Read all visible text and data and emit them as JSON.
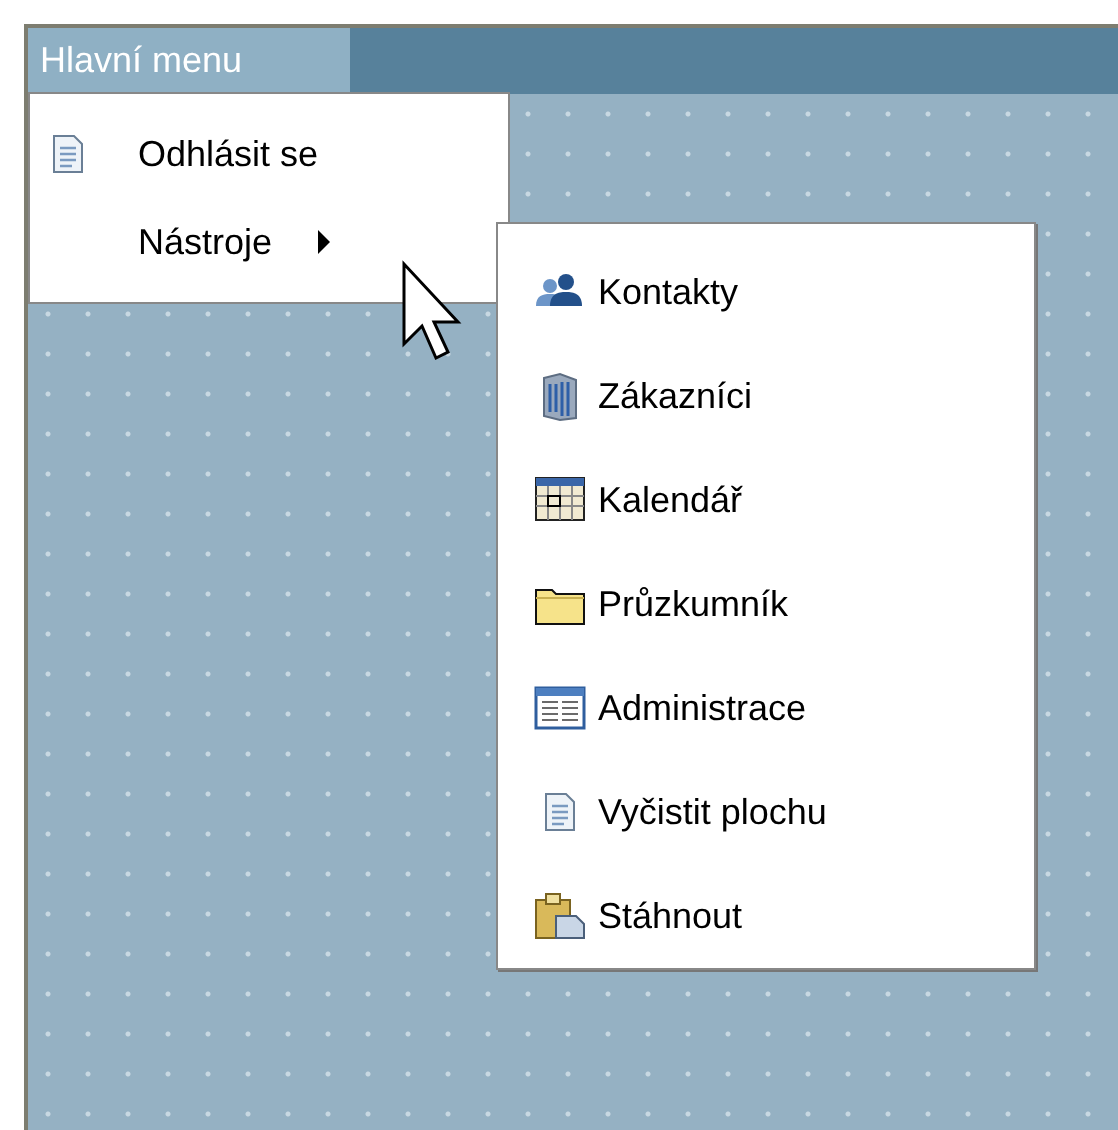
{
  "menu_bar": {
    "title": "Hlavní menu"
  },
  "main_menu": {
    "items": [
      {
        "label": "Odhlásit se",
        "kind": "action"
      },
      {
        "label": "Nástroje",
        "kind": "submenu"
      }
    ]
  },
  "submenu": {
    "items": [
      {
        "label": "Kontakty"
      },
      {
        "label": "Zákazníci"
      },
      {
        "label": "Kalendář"
      },
      {
        "label": "Průzkumník"
      },
      {
        "label": "Administrace"
      },
      {
        "label": "Vyčistit plochu"
      },
      {
        "label": "Stáhnout"
      }
    ]
  }
}
